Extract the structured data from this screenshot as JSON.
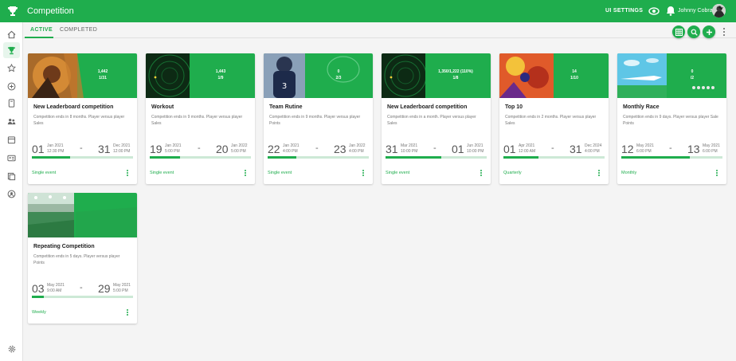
{
  "app": {
    "title": "Competition"
  },
  "header": {
    "ui_settings": "UI SETTINGS",
    "user_name": "Johnny Cobra"
  },
  "tabs": {
    "active": "ACTIVE",
    "completed": "COMPLETED"
  },
  "colors": {
    "brand": "#1fad4d",
    "progress_track": "#cde9d6"
  },
  "cards": [
    {
      "title": "New Leaderboard competition",
      "desc": "Competition ends in 8 months. Player versus player Sales",
      "img_top": "1,442",
      "img_bottom": "1/31",
      "start_day": "01",
      "start_month": "Jan 2021",
      "start_time": "12:30 PM",
      "end_day": "31",
      "end_month": "Dec 2021",
      "end_time": "12:00 PM",
      "freq": "Single event",
      "progress": 0.38
    },
    {
      "title": "Workout",
      "desc": "Competition ends in 9 months. Player versus player Sales",
      "img_top": "1,443",
      "img_bottom": "1/9",
      "start_day": "19",
      "start_month": "Jan 2021",
      "start_time": "5:00 PM",
      "end_day": "20",
      "end_month": "Jan 2022",
      "end_time": "5:00 PM",
      "freq": "Single event",
      "progress": 0.3
    },
    {
      "title": "Team Rutine",
      "desc": "Competition ends in 9 months. Player versus player Points",
      "img_top": "0",
      "img_bottom": "2/3",
      "start_day": "22",
      "start_month": "Jan 2021",
      "start_time": "4:00 PM",
      "end_day": "23",
      "end_month": "Jan 2022",
      "end_time": "4:00 PM",
      "freq": "Single event",
      "progress": 0.28
    },
    {
      "title": "New Leaderboard competition",
      "desc": "Competition ends in a month. Player versus player Sales",
      "img_top": "1,350/1,222 (110%)",
      "img_bottom": "1/8",
      "start_day": "31",
      "start_month": "Mar 2021",
      "start_time": "10:00 PM",
      "end_day": "01",
      "end_month": "Jun 2021",
      "end_time": "10:00 PM",
      "freq": "Single event",
      "progress": 0.55
    },
    {
      "title": "Top 10",
      "desc": "Competition ends in 2 months. Player versus player Sales",
      "img_top": "14",
      "img_bottom": "1/10",
      "start_day": "01",
      "start_month": "Apr 2021",
      "start_time": "12:00 AM",
      "end_day": "31",
      "end_month": "Dec 2024",
      "end_time": "4:00 PM",
      "freq": "Quarterly",
      "progress": 0.35
    },
    {
      "title": "Monthly Race",
      "desc": "Competition ends in 9 days. Player versus player Sale Points",
      "img_top": "0",
      "img_bottom": "/2",
      "start_day": "12",
      "start_month": "May 2021",
      "start_time": "6:00 PM",
      "end_day": "13",
      "end_month": "May 2021",
      "end_time": "6:00 PM",
      "freq": "Monthly",
      "progress": 0.68
    },
    {
      "title": "Repeating Competition",
      "desc": "Competition ends in 5 days. Player versus player Points",
      "img_top": "",
      "img_bottom": "",
      "start_day": "03",
      "start_month": "May 2021",
      "start_time": "9:00 AM",
      "end_day": "29",
      "end_month": "May 2021",
      "end_time": "5:00 PM",
      "freq": "Weekly",
      "progress": 0.12
    }
  ],
  "icons": {
    "top": [
      "trophy-icon",
      "eye-icon",
      "bell-icon"
    ],
    "sidebar": [
      "home-icon",
      "trophy-icon",
      "star-icon",
      "plus-circle-icon",
      "book-icon",
      "people-icon",
      "calendar-icon",
      "id-card-icon",
      "gift-icon",
      "user-circle-icon",
      "gear-icon"
    ],
    "actions": [
      "grid-view-icon",
      "search-icon",
      "plus-icon",
      "more-vert-icon"
    ]
  }
}
